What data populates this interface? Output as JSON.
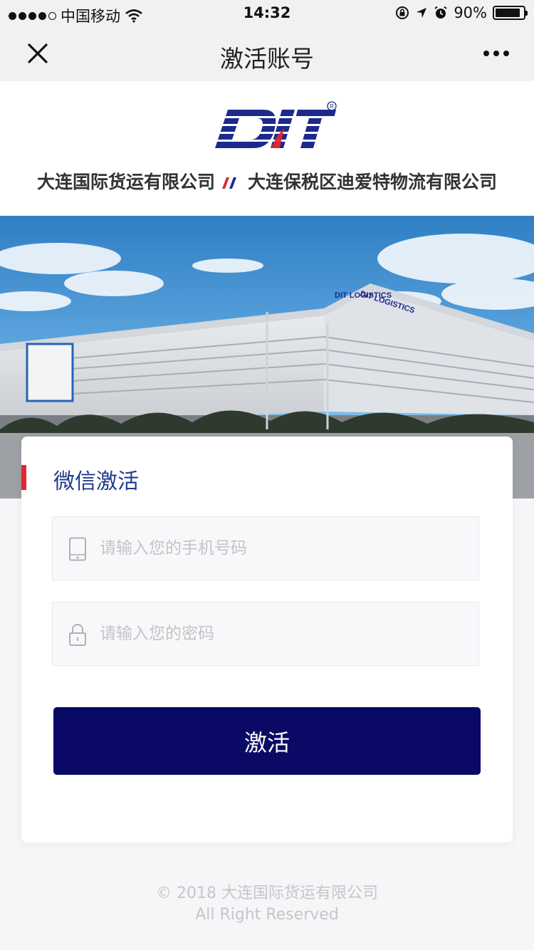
{
  "status_bar": {
    "carrier": "中国移动",
    "time": "14:32",
    "battery": "90%",
    "battery_level": 0.9,
    "signal_dots_filled": 4,
    "icons": [
      "wifi-icon",
      "orientation-lock-icon",
      "location-icon",
      "alarm-icon",
      "battery-icon"
    ]
  },
  "nav": {
    "title": "激活账号",
    "close_icon": "close-icon",
    "more_icon": "more-icon"
  },
  "header": {
    "logo_text": "DIT",
    "registered_mark": "®",
    "company_1": "大连国际货运有限公司",
    "company_2": "大连保税区迪爱特物流有限公司"
  },
  "banner": {
    "building_sign_1": "DIT LOGISTICS",
    "building_sign_2": "DIT LOGISTICS"
  },
  "form": {
    "title": "微信激活",
    "phone_placeholder": "请输入您的手机号码",
    "phone_value": "",
    "password_placeholder": "请输入您的密码",
    "password_value": "",
    "submit_label": "激活",
    "phone_icon": "phone-icon",
    "lock_icon": "lock-icon"
  },
  "colors": {
    "accent_red": "#e0262f",
    "title_blue": "#1f3b8f",
    "button_navy": "#0a0a66",
    "logo_blue": "#1c2a8c"
  },
  "footer": {
    "copyright": "© 2018 大连国际货运有限公司",
    "rights": "All Right Reserved"
  }
}
